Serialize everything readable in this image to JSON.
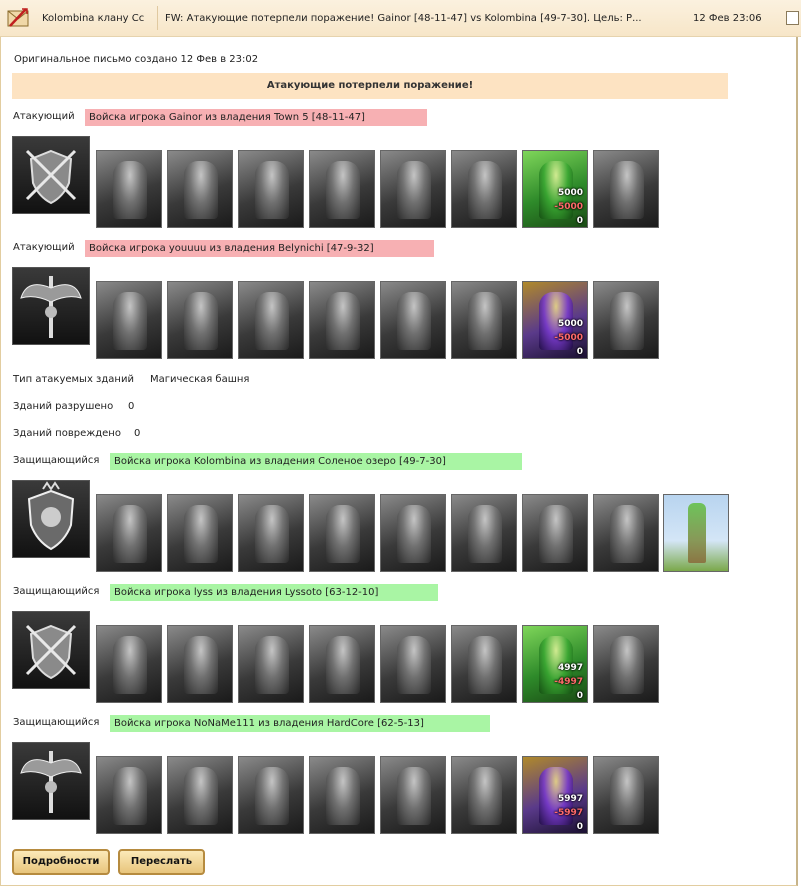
{
  "header": {
    "from": "Kolombina клану Cc",
    "subject": "FW: Атакующие потерпели поражение! Gainor [48-11-47] vs Kolombina [49-7-30]. Цель: Р...",
    "date": "12 Фев 23:06"
  },
  "original_created": "Оригинальное письмо создано 12 Фев в 23:02",
  "result_banner": "Атакующие потерпели поражение!",
  "armies": [
    {
      "role": "Атакующий",
      "title": "Войска игрока Gainor из владения Town 5 [48-11-47]",
      "side": "attacker",
      "hero": {
        "style": "hero-green",
        "stat1": "5000",
        "stat2": "-5000",
        "stat3": "0"
      }
    },
    {
      "role": "Атакующий",
      "title": "Войска игрока youuuu из владения Belynichi [47-9-32]",
      "side": "attacker",
      "hero": {
        "style": "hero-purple",
        "stat1": "5000",
        "stat2": "-5000",
        "stat3": "0"
      }
    },
    {
      "role": "Защищающийся",
      "title": "Войска игрока Kolombina из владения Соленое озеро [49-7-30]",
      "side": "defender",
      "hero": null
    },
    {
      "role": "Защищающийся",
      "title": "Войска игрока lyss из владения Lyssoto [63-12-10]",
      "side": "defender",
      "hero": {
        "style": "hero-green",
        "stat1": "4997",
        "stat2": "-4997",
        "stat3": "0"
      }
    },
    {
      "role": "Защищающийся",
      "title": "Войска игрока NoNaMe111 из владения HardCore [62-5-13]",
      "side": "defender",
      "hero": {
        "style": "hero-purple",
        "stat1": "5997",
        "stat2": "-5997",
        "stat3": "0"
      }
    }
  ],
  "building_info": {
    "type_label": "Тип атакуемых зданий",
    "type_value": "Магическая башня",
    "destroyed_label": "Зданий разрушено",
    "destroyed_value": "0",
    "damaged_label": "Зданий повреждено",
    "damaged_value": "0"
  },
  "buttons": {
    "details": "Подробности",
    "forward": "Переслать"
  },
  "colors": {
    "attacker_bar": "#f7b0b3",
    "defender_bar": "#a9f5a4",
    "banner": "#fde3c2"
  }
}
